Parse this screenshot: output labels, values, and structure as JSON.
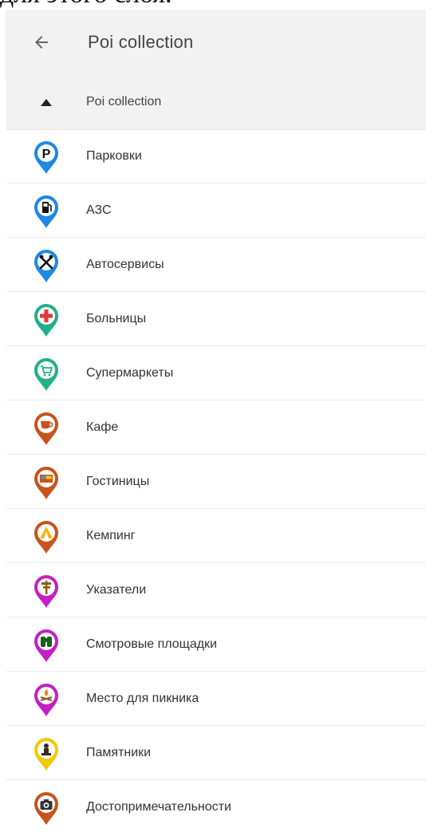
{
  "page_header_text": "для этого слоя.",
  "appbar": {
    "title": "Poi collection"
  },
  "section": {
    "label": "Poi collection"
  },
  "items": [
    {
      "label": "Парковки",
      "color": "#1e88e5",
      "icon": "parking-icon"
    },
    {
      "label": "АЗС",
      "color": "#1e88e5",
      "icon": "fuel-station-icon"
    },
    {
      "label": "Автосервисы",
      "color": "#1e88e5",
      "icon": "car-service-icon"
    },
    {
      "label": "Больницы",
      "color": "#20b08a",
      "icon": "hospital-icon"
    },
    {
      "label": "Супермаркеты",
      "color": "#20b08a",
      "icon": "supermarket-icon"
    },
    {
      "label": "Кафе",
      "color": "#c6541c",
      "icon": "cafe-icon"
    },
    {
      "label": "Гостиницы",
      "color": "#c6541c",
      "icon": "hotel-icon"
    },
    {
      "label": "Кемпинг",
      "color": "#c6541c",
      "icon": "camping-icon"
    },
    {
      "label": "Указатели",
      "color": "#c41fc4",
      "icon": "signpost-icon"
    },
    {
      "label": "Смотровые площадки",
      "color": "#c41fc4",
      "icon": "viewpoint-icon"
    },
    {
      "label": "Место для пикника",
      "color": "#c41fc4",
      "icon": "picnic-icon"
    },
    {
      "label": "Памятники",
      "color": "#f5c800",
      "icon": "monument-icon"
    },
    {
      "label": "Достопримечательности",
      "color": "#c6541c",
      "icon": "landmark-icon"
    }
  ]
}
